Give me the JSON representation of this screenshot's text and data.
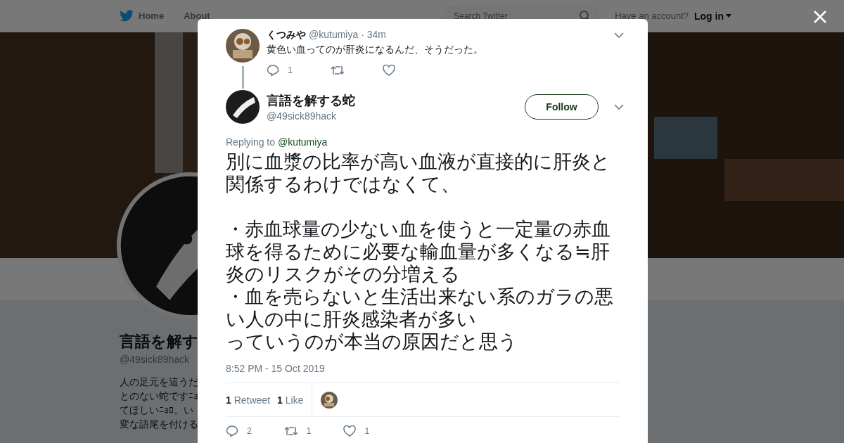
{
  "nav": {
    "items": [
      "Home",
      "About"
    ],
    "search": {
      "placeholder": "Search Twitter"
    },
    "account_prompt": "Have an account?",
    "login": "Log in"
  },
  "profile": {
    "name": "言語を解す",
    "handle": "@49sick89hack",
    "bio_lines": [
      "人の足元を這うだ",
      "とのない蛇ですﾆｮ",
      "てほしいﾆｮﾛ。い",
      "変な語尾を付ける"
    ]
  },
  "parent_tweet": {
    "name": "くつみや",
    "handle": "@kutumiya",
    "time": "· 34m",
    "text": "黄色い血ってのが肝炎になるんだ、そうだった。",
    "replies": "1"
  },
  "tweet": {
    "name": "言語を解する蛇",
    "handle": "@49sick89hack",
    "follow": "Follow",
    "replying_label": "Replying to",
    "replying_to": "@kutumiya",
    "paragraphs": [
      "別に血漿の比率が高い血液が直接的に肝炎と関係するわけではなくて、",
      "・赤血球量の少ない血を使うと一定量の赤血球を得るために必要な輸血量が多くなる≒肝炎のリスクがその分増える",
      "・血を売らないと生活出来ない系のガラの悪い人の中に肝炎感染者が多い",
      "っていうのが本当の原因だと思う"
    ],
    "timestamp": "8:52 PM - 15 Oct 2019",
    "retweets": "1",
    "retweets_label": "Retweet",
    "likes": "1",
    "likes_label": "Like",
    "reply_count": "2",
    "retweet_count": "1",
    "like_count": "1"
  }
}
